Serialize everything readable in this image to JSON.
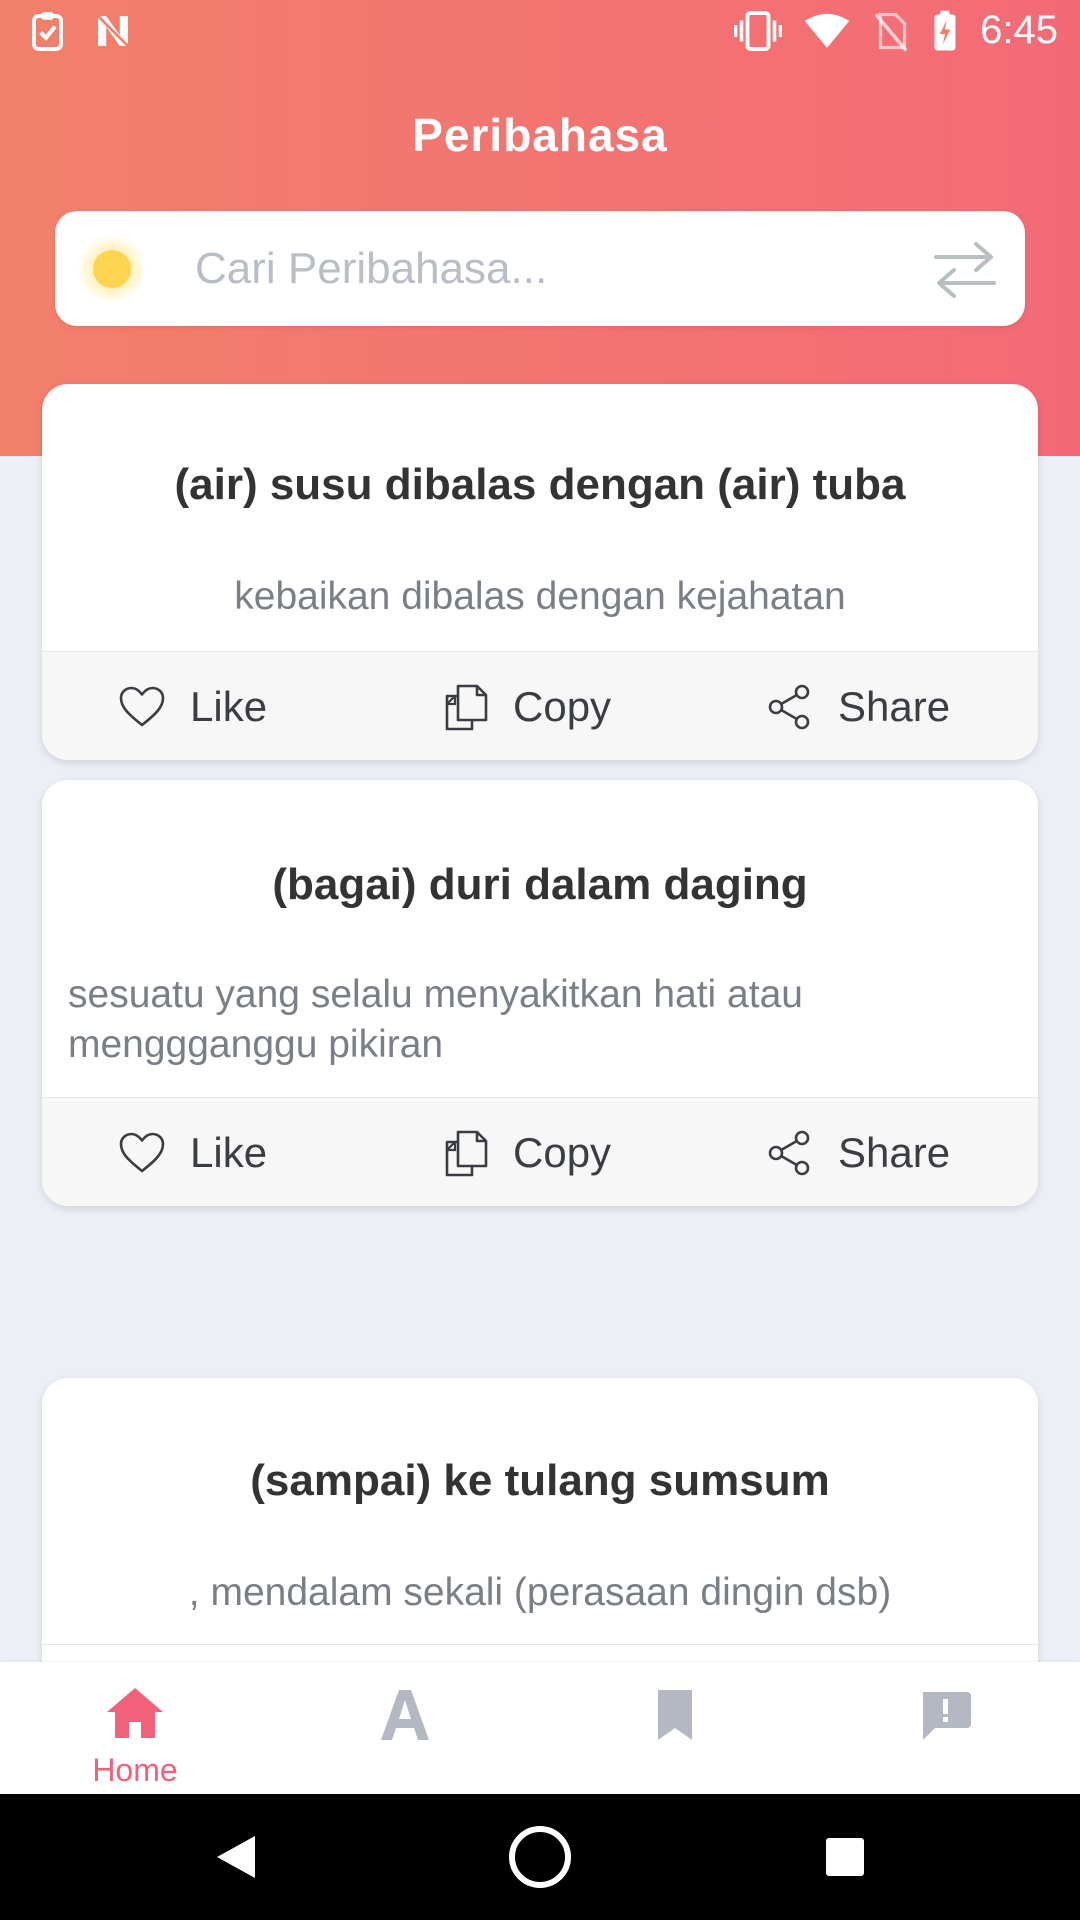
{
  "status_bar": {
    "time": "6:45",
    "left_icons": [
      "task-check-icon",
      "n-logo-icon"
    ],
    "right_icons": [
      "vibrate-icon",
      "wifi-icon",
      "no-sim-icon",
      "battery-charging-icon"
    ]
  },
  "header": {
    "title": "Peribahasa"
  },
  "search": {
    "placeholder": "Cari Peribahasa...",
    "value": ""
  },
  "cards": [
    {
      "title": "(air) susu dibalas dengan (air) tuba",
      "meaning": "kebaikan dibalas dengan kejahatan",
      "actions": {
        "like": "Like",
        "copy": "Copy",
        "share": "Share"
      }
    },
    {
      "title": "(bagai) duri dalam daging",
      "meaning": " sesuatu yang selalu menyakitkan hati atau menggganggu pikiran",
      "actions": {
        "like": "Like",
        "copy": "Copy",
        "share": "Share"
      }
    },
    {
      "title": "(sampai) ke tulang sumsum",
      "meaning": ", mendalam sekali (perasaan dingin dsb)"
    }
  ],
  "bottom_nav": {
    "items": [
      {
        "icon": "home-icon",
        "label": "Home",
        "active": true
      },
      {
        "icon": "letter-a-icon",
        "label": "",
        "active": false
      },
      {
        "icon": "bookmark-icon",
        "label": "",
        "active": false
      },
      {
        "icon": "feedback-icon",
        "label": "",
        "active": false
      }
    ]
  },
  "colors": {
    "header_start": "#F2806A",
    "header_end": "#F36A77",
    "accent": "#F3607A",
    "background": "#ECEFF6",
    "inactive_nav": "#B4B8C2"
  }
}
